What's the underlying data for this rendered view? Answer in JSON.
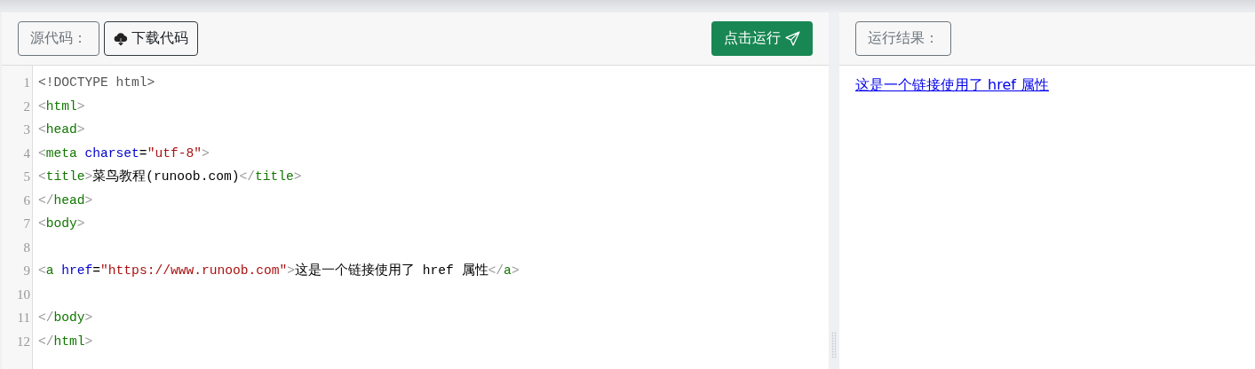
{
  "source_panel": {
    "label": "源代码：",
    "download_button": "下载代码",
    "run_button": "点击运行",
    "lines": [
      {
        "number": "1",
        "tokens": [
          {
            "kind": "meta",
            "text": "<!DOCTYPE html>"
          }
        ]
      },
      {
        "number": "2",
        "tokens": [
          {
            "kind": "punct",
            "text": "<"
          },
          {
            "kind": "tag",
            "text": "html"
          },
          {
            "kind": "punct",
            "text": ">"
          }
        ]
      },
      {
        "number": "3",
        "tokens": [
          {
            "kind": "punct",
            "text": "<"
          },
          {
            "kind": "tag",
            "text": "head"
          },
          {
            "kind": "punct",
            "text": ">"
          }
        ]
      },
      {
        "number": "4",
        "tokens": [
          {
            "kind": "punct",
            "text": "<"
          },
          {
            "kind": "tag",
            "text": "meta"
          },
          {
            "kind": "attr",
            "text": " charset"
          },
          {
            "kind": "text",
            "text": "="
          },
          {
            "kind": "string",
            "text": "\"utf-8\""
          },
          {
            "kind": "punct",
            "text": ">"
          }
        ]
      },
      {
        "number": "5",
        "tokens": [
          {
            "kind": "punct",
            "text": "<"
          },
          {
            "kind": "tag",
            "text": "title"
          },
          {
            "kind": "punct",
            "text": ">"
          },
          {
            "kind": "text",
            "text": "菜鸟教程(runoob.com)"
          },
          {
            "kind": "punct",
            "text": "</"
          },
          {
            "kind": "tag",
            "text": "title"
          },
          {
            "kind": "punct",
            "text": ">"
          }
        ]
      },
      {
        "number": "6",
        "tokens": [
          {
            "kind": "punct",
            "text": "</"
          },
          {
            "kind": "tag",
            "text": "head"
          },
          {
            "kind": "punct",
            "text": ">"
          }
        ]
      },
      {
        "number": "7",
        "tokens": [
          {
            "kind": "punct",
            "text": "<"
          },
          {
            "kind": "tag",
            "text": "body"
          },
          {
            "kind": "punct",
            "text": ">"
          }
        ]
      },
      {
        "number": "8"
      },
      {
        "number": "9",
        "tokens": [
          {
            "kind": "punct",
            "text": "<"
          },
          {
            "kind": "tag",
            "text": "a"
          },
          {
            "kind": "attr",
            "text": " href"
          },
          {
            "kind": "text",
            "text": "="
          },
          {
            "kind": "string",
            "text": "\"https://www.runoob.com\""
          },
          {
            "kind": "punct",
            "text": ">"
          },
          {
            "kind": "text",
            "text": "这是一个链接使用了 href 属性"
          },
          {
            "kind": "punct",
            "text": "</"
          },
          {
            "kind": "tag",
            "text": "a"
          },
          {
            "kind": "punct",
            "text": ">"
          }
        ]
      },
      {
        "number": "10"
      },
      {
        "number": "11",
        "tokens": [
          {
            "kind": "punct",
            "text": "</"
          },
          {
            "kind": "tag",
            "text": "body"
          },
          {
            "kind": "punct",
            "text": ">"
          }
        ]
      },
      {
        "number": "12",
        "tokens": [
          {
            "kind": "punct",
            "text": "</"
          },
          {
            "kind": "tag",
            "text": "html"
          },
          {
            "kind": "punct",
            "text": ">"
          }
        ]
      }
    ]
  },
  "result_panel": {
    "label": "运行结果：",
    "link": "这是一个链接使用了 href 属性"
  }
}
